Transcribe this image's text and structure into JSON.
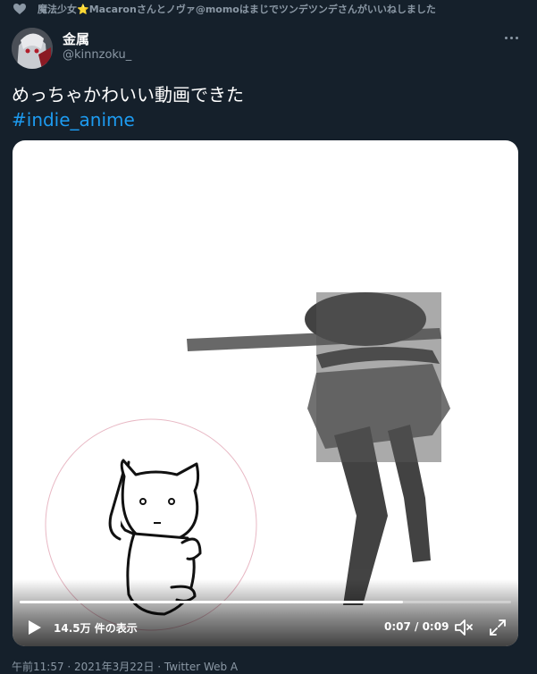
{
  "social_context": {
    "text": "魔法少女⭐Macaronさんとノヴァ@momoはまじでツンデツンデさんがいいねしました"
  },
  "author": {
    "name": "金属",
    "handle": "@kinnzoku_"
  },
  "tweet": {
    "text": "めっちゃかわいい動画できた",
    "hashtag": "#indie_anime"
  },
  "video": {
    "views": "14.5万 件の表示",
    "time": "0:07 / 0:09",
    "progress": 0.78
  },
  "footer": {
    "timestamp": "午前11:57 · 2021年3月22日 · Twitter Web A"
  },
  "colors": {
    "background": "#15202b",
    "accent": "#1d9bf0",
    "muted": "#8b98a5"
  },
  "icons": {
    "liked": "heart-icon",
    "more": "more-icon",
    "play": "play-icon",
    "volume": "volume-icon",
    "fullscreen": "fullscreen-icon"
  }
}
